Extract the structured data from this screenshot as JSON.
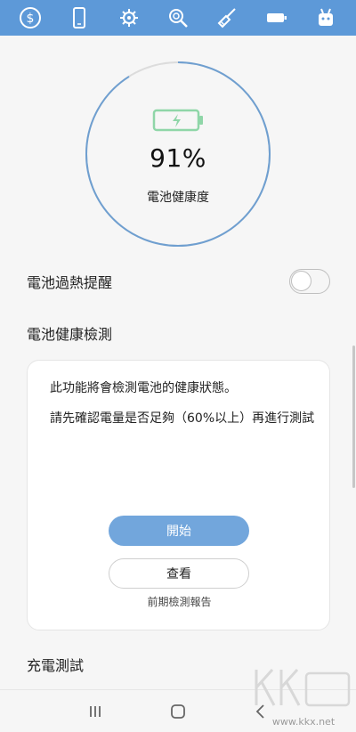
{
  "topbar": {
    "color": "#5d99d8",
    "tabs": [
      {
        "icon": "dollar-icon"
      },
      {
        "icon": "phone-icon"
      },
      {
        "icon": "cpu-gear-icon"
      },
      {
        "icon": "magnifier-icon"
      },
      {
        "icon": "broom-icon"
      },
      {
        "icon": "battery-icon"
      },
      {
        "icon": "robot-icon"
      }
    ]
  },
  "gauge": {
    "value": "91%",
    "label": "電池健康度",
    "fraction": 0.91,
    "arc_color": "#6f9fd0",
    "track_color": "#dcdcdc",
    "battery_color": "#8fd6a8"
  },
  "overheat": {
    "label": "電池過熱提醒",
    "enabled": false
  },
  "health_check": {
    "heading": "電池健康檢測",
    "description": "此功能將會檢測電池的健康狀態。",
    "instruction": "請先確認電量是否足夠（60%以上）再進行測試",
    "start_button": "開始",
    "view_button": "查看",
    "caption": "前期檢測報告"
  },
  "charging_test": {
    "label": "充電測試"
  },
  "navbar": {
    "recent_icon": "recent-apps-icon",
    "home_icon": "home-icon",
    "back_icon": "back-icon"
  },
  "watermark": {
    "url": "www.kkx.net"
  }
}
